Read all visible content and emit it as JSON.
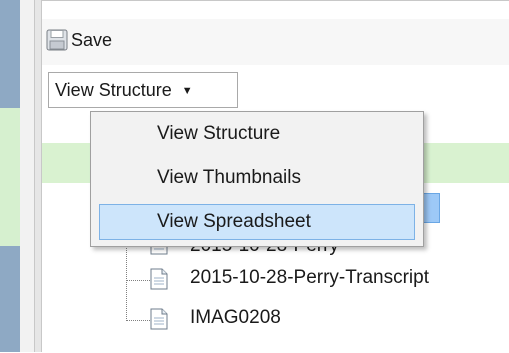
{
  "toolbar": {
    "save_label": "Save"
  },
  "view_dropdown": {
    "selected": "View Structure"
  },
  "view_menu": {
    "items": [
      {
        "label": "View Structure"
      },
      {
        "label": "View Thumbnails"
      },
      {
        "label": "View Spreadsheet"
      }
    ],
    "highlighted_index": 2
  },
  "tree": {
    "items": [
      {
        "label": "2015-10-28-Perry"
      },
      {
        "label": "2015-10-28-Perry-Transcript"
      },
      {
        "label": "IMAG0208"
      }
    ],
    "selected_fragment": "ry"
  },
  "colors": {
    "accent_selected": "#9dc9f7",
    "menu_hover": "#cde5fb",
    "green_band": "#d9f2d0",
    "left_strip": "#8ea9c4"
  },
  "icons": {
    "save": "floppy-disk-icon",
    "dropdown": "chevron-down-icon",
    "tree_item": "document-icon"
  }
}
